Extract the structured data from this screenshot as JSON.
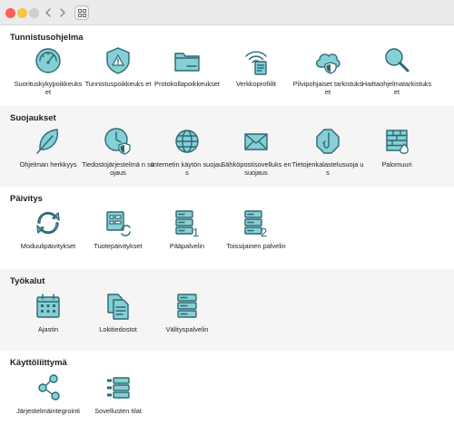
{
  "sections": [
    {
      "title": "Tunnistusohjelma",
      "items": [
        {
          "label": "Suorituskykypoikkeuks et",
          "icon": "gauge-icon"
        },
        {
          "label": "Tunnistuspoikkeuks et",
          "icon": "shield-warning-icon"
        },
        {
          "label": "Protokollapoikkeukset",
          "icon": "folder-icon"
        },
        {
          "label": "Verkkoprofiilit",
          "icon": "wifi-document-icon"
        },
        {
          "label": "Pilvipohjaiset tarkistukset",
          "icon": "cloud-shield-icon"
        },
        {
          "label": "Haittaohjelmatarkistuks et",
          "icon": "magnifier-icon"
        }
      ]
    },
    {
      "title": "Suojaukset",
      "items": [
        {
          "label": "Ohjelman herkkyys",
          "icon": "feather-icon"
        },
        {
          "label": "Tiedostojärjestelmä n suojaus",
          "icon": "clock-shield-icon"
        },
        {
          "label": "Internetin käytön suojaus",
          "icon": "globe-icon"
        },
        {
          "label": "Sähköpostisovelluks en suojaus",
          "icon": "envelope-icon"
        },
        {
          "label": "Tietojenkalastelusuoja us",
          "icon": "hook-icon"
        },
        {
          "label": "Palomuuri",
          "icon": "firewall-icon"
        }
      ]
    },
    {
      "title": "Päivitys",
      "items": [
        {
          "label": "Moduulipäivitykset",
          "icon": "refresh-icon"
        },
        {
          "label": "Tuotepäivitykset",
          "icon": "product-update-icon"
        },
        {
          "label": "Pääpalvelin",
          "icon": "server-1-icon",
          "badge": "1"
        },
        {
          "label": "Toissijainen palvelin",
          "icon": "server-2-icon",
          "badge": "2"
        }
      ]
    },
    {
      "title": "Työkalut",
      "items": [
        {
          "label": "Ajastin",
          "icon": "calendar-icon"
        },
        {
          "label": "Lokitiedostot",
          "icon": "documents-icon"
        },
        {
          "label": "Välityspalvelin",
          "icon": "proxy-server-icon"
        }
      ]
    },
    {
      "title": "Käyttöliittymä",
      "items": [
        {
          "label": "Järjestelmäintegrointi",
          "icon": "integration-icon"
        },
        {
          "label": "Sovellusten tilat",
          "icon": "app-states-icon"
        }
      ]
    }
  ]
}
